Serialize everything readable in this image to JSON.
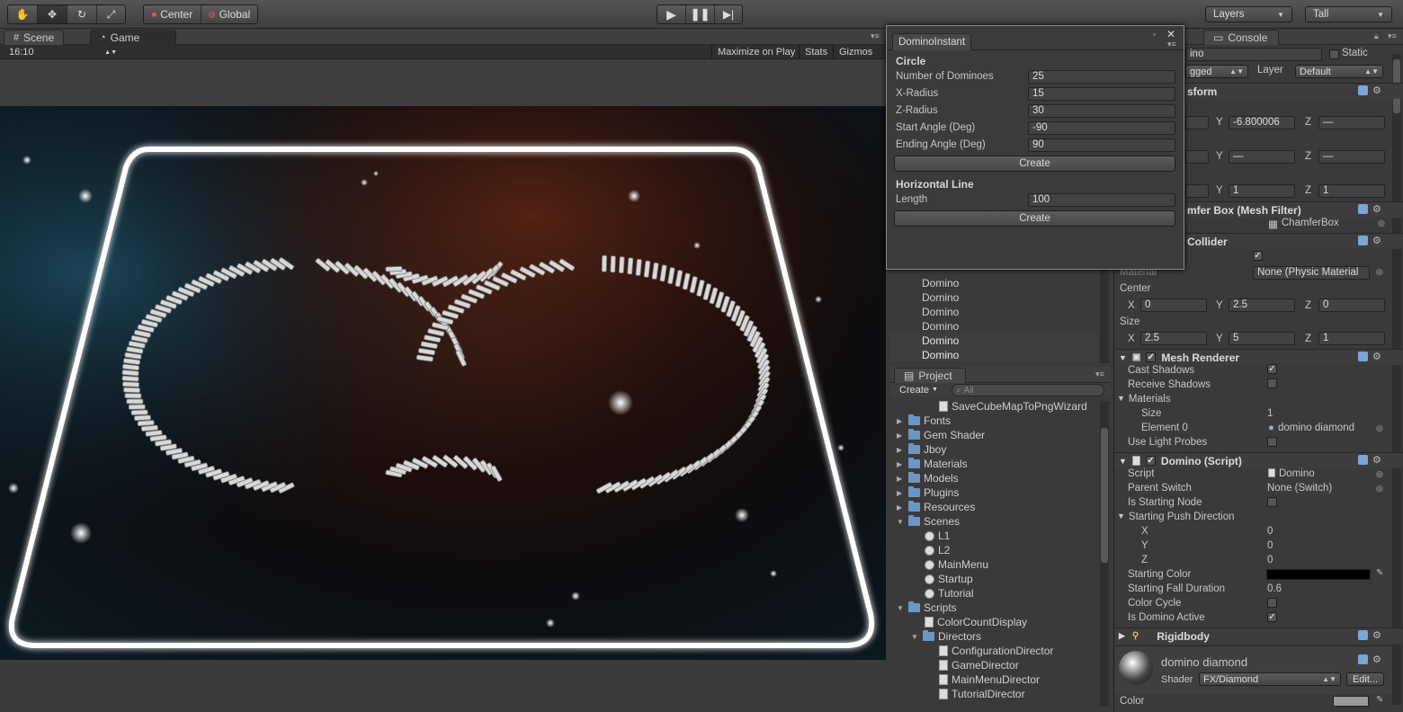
{
  "toolbar": {
    "pivot": "Center",
    "space": "Global",
    "layers": "Layers",
    "layout": "Tall",
    "tools": [
      "hand-icon",
      "move-icon",
      "rotate-icon",
      "scale-icon"
    ],
    "play": [
      "play-icon",
      "pause-icon",
      "step-icon"
    ]
  },
  "scene_tabs": {
    "scene": "Scene",
    "game": "Game"
  },
  "game_bar": {
    "aspect": "16:10",
    "maximize": "Maximize on Play",
    "stats": "Stats",
    "gizmos": "Gizmos"
  },
  "domino_window": {
    "title": "DominoInstant",
    "circle": {
      "heading": "Circle",
      "fields": [
        {
          "label": "Number of Dominoes",
          "value": "25"
        },
        {
          "label": "X-Radius",
          "value": "15"
        },
        {
          "label": "Z-Radius",
          "value": "30"
        },
        {
          "label": "Start Angle (Deg)",
          "value": "-90"
        },
        {
          "label": "Ending Angle (Deg)",
          "value": "90"
        }
      ],
      "button": "Create"
    },
    "line": {
      "heading": "Horizontal Line",
      "fields": [
        {
          "label": "Length",
          "value": "100"
        }
      ],
      "button": "Create"
    }
  },
  "hierarchy": {
    "items": [
      "Domino",
      "Domino",
      "Domino",
      "Domino",
      "Domino",
      "Domino"
    ]
  },
  "project": {
    "tab": "Project",
    "create": "Create",
    "search_placeholder": "All",
    "items": [
      {
        "type": "file",
        "depth": 2,
        "name": "SaveCubeMapToPngWizard"
      },
      {
        "type": "folder",
        "depth": 0,
        "name": "Fonts"
      },
      {
        "type": "folder",
        "depth": 0,
        "name": "Gem Shader"
      },
      {
        "type": "folder",
        "depth": 0,
        "name": "Jboy"
      },
      {
        "type": "folder",
        "depth": 0,
        "name": "Materials"
      },
      {
        "type": "folder",
        "depth": 0,
        "name": "Models"
      },
      {
        "type": "folder",
        "depth": 0,
        "name": "Plugins"
      },
      {
        "type": "folder",
        "depth": 0,
        "name": "Resources"
      },
      {
        "type": "folder",
        "depth": 0,
        "name": "Scenes",
        "open": true
      },
      {
        "type": "scene",
        "depth": 1,
        "name": "L1"
      },
      {
        "type": "scene",
        "depth": 1,
        "name": "L2"
      },
      {
        "type": "scene",
        "depth": 1,
        "name": "MainMenu"
      },
      {
        "type": "scene",
        "depth": 1,
        "name": "Startup"
      },
      {
        "type": "scene",
        "depth": 1,
        "name": "Tutorial"
      },
      {
        "type": "folder",
        "depth": 0,
        "name": "Scripts",
        "open": true
      },
      {
        "type": "file",
        "depth": 1,
        "name": "ColorCountDisplay"
      },
      {
        "type": "folder",
        "depth": 1,
        "name": "Directors",
        "open": true
      },
      {
        "type": "file",
        "depth": 2,
        "name": "ConfigurationDirector"
      },
      {
        "type": "file",
        "depth": 2,
        "name": "GameDirector"
      },
      {
        "type": "file",
        "depth": 2,
        "name": "MainMenuDirector"
      },
      {
        "type": "file",
        "depth": 2,
        "name": "TutorialDirector"
      }
    ]
  },
  "inspector": {
    "console_tab": "Console",
    "name_value": "ino",
    "static_label": "Static",
    "tag_value": "gged",
    "layer_label": "Layer",
    "layer_value": "Default",
    "transform_heading": "sform",
    "transform_y_label": "Y",
    "transform_z_label": "Z",
    "position_y": "-6.800006",
    "position_z": "—",
    "rotation_y": "—",
    "rotation_z": "—",
    "scale_y": "1",
    "scale_z": "1",
    "mesh_filter": "mfer Box (Mesh Filter)",
    "mesh_value": "ChamferBox",
    "collider_heading": "Collider",
    "material_label": "Material",
    "material_value": "None (Physic Material",
    "center_label": "Center",
    "center": {
      "x": "0",
      "y": "2.5",
      "z": "0"
    },
    "size_label": "Size",
    "size": {
      "x": "2.5",
      "y": "5",
      "z": "1"
    },
    "axis_labels": {
      "x": "X",
      "y": "Y",
      "z": "Z"
    },
    "mesh_renderer": {
      "heading": "Mesh Renderer",
      "cast_shadows": "Cast Shadows",
      "receive_shadows": "Receive Shadows",
      "materials": "Materials",
      "size_label": "Size",
      "size_value": "1",
      "element_label": "Element 0",
      "element_value": "domino diamond",
      "use_light_probes": "Use Light Probes"
    },
    "domino_script": {
      "heading": "Domino (Script)",
      "script_label": "Script",
      "script_value": "Domino",
      "parent_switch_label": "Parent Switch",
      "parent_switch_value": "None (Switch)",
      "is_starting_node": "Is Starting Node",
      "starting_push_direction": "Starting Push Direction",
      "dir": {
        "x": "0",
        "y": "0",
        "z": "0"
      },
      "starting_color": "Starting Color",
      "starting_color_hex": "#000000",
      "starting_fall_duration_label": "Starting Fall Duration",
      "starting_fall_duration": "0.6",
      "color_cycle": "Color Cycle",
      "is_domino_active": "Is Domino Active"
    },
    "rigidbody": "Rigidbody",
    "material_name": "domino diamond",
    "shader_label": "Shader",
    "shader_value": "FX/Diamond",
    "edit_button": "Edit...",
    "color_label": "Color"
  }
}
